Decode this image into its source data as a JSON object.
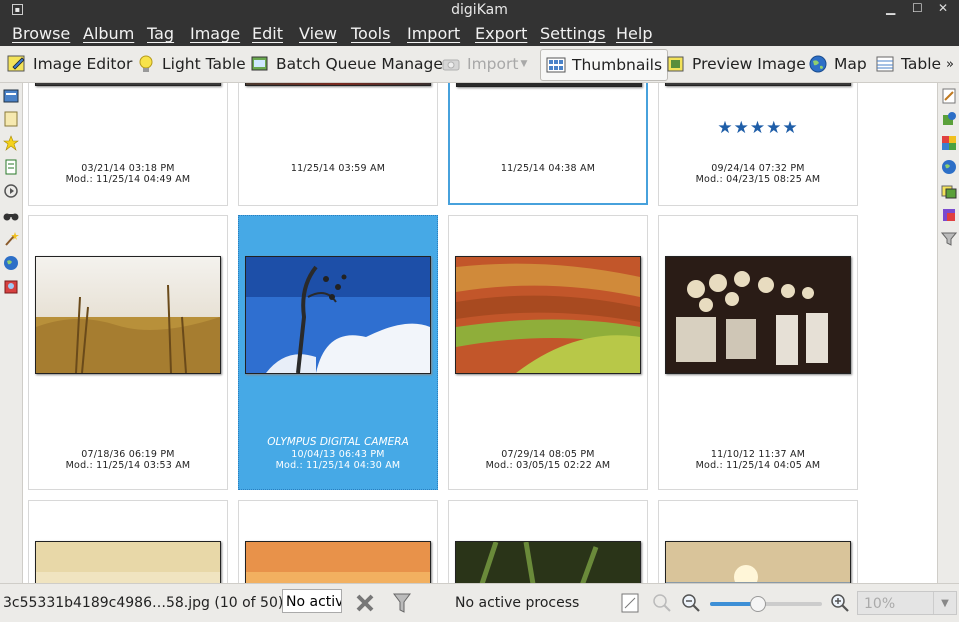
{
  "window": {
    "title": "digiKam"
  },
  "menu": [
    "Browse",
    "Album",
    "Tag",
    "Image",
    "Edit",
    "View",
    "Tools",
    "Import",
    "Export",
    "Settings",
    "Help"
  ],
  "toolbar": {
    "image_editor": "Image Editor",
    "light_table": "Light Table",
    "batch_queue": "Batch Queue Manager",
    "import": "Import",
    "thumbnails": "Thumbnails",
    "preview": "Preview Image",
    "map": "Map",
    "table": "Table"
  },
  "thumbnails": [
    {
      "date": "03/21/14 03:18 PM",
      "mod": "Mod.: 11/25/14 04:49 AM"
    },
    {
      "date": "11/25/14 03:59 AM",
      "mod": ""
    },
    {
      "date": "11/25/14 04:38 AM",
      "mod": ""
    },
    {
      "date": "09/24/14 07:32 PM",
      "mod": "Mod.: 04/23/15 08:25 AM",
      "stars": "★★★★★",
      "rating": 5
    },
    {
      "date": "07/18/36 06:19 PM",
      "mod": "Mod.: 11/25/14 03:53 AM"
    },
    {
      "caption": "OLYMPUS DIGITAL CAMERA",
      "date": "10/04/13 06:43 PM",
      "mod": "Mod.: 11/25/14 04:30 AM",
      "selected": true
    },
    {
      "date": "07/29/14 08:05 PM",
      "mod": "Mod.: 03/05/15 02:22 AM"
    },
    {
      "date": "11/10/12 11:37 AM",
      "mod": "Mod.: 11/25/14 04:05 AM"
    }
  ],
  "status": {
    "filename": "3c55331b4189c4986…58.jpg (10 of 50)",
    "filter_text": "No active filter",
    "process": "No active process",
    "zoom_slider_fraction": 0.42,
    "zoom": "10%"
  },
  "colors": {
    "bar_dark": "#333333",
    "selection": "#46a9e6",
    "accent": "#3d8fd6",
    "stars": "#1f5ea8"
  }
}
